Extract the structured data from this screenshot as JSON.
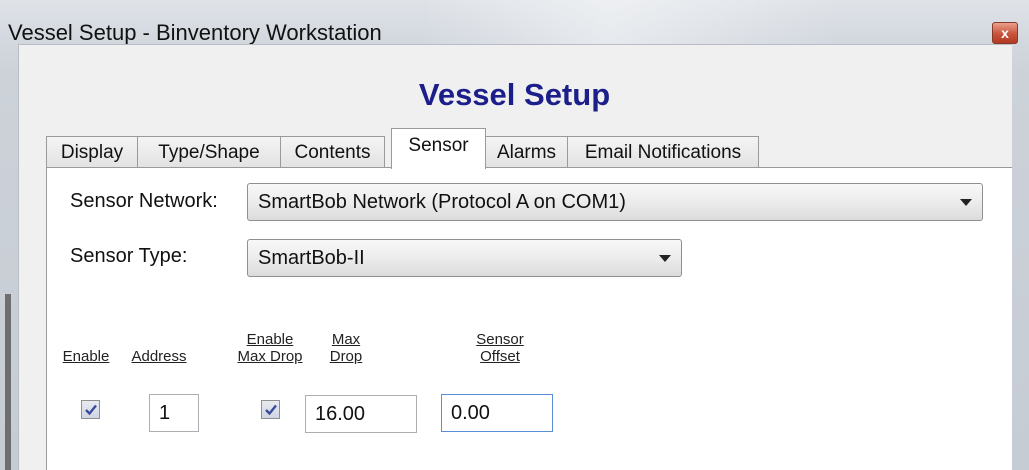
{
  "window": {
    "title": "Vessel Setup - Binventory Workstation",
    "close_glyph": "x"
  },
  "heading": "Vessel Setup",
  "tabs": [
    {
      "label": "Display",
      "active": false
    },
    {
      "label": "Type/Shape",
      "active": false
    },
    {
      "label": "Contents",
      "active": false
    },
    {
      "label": "Sensor",
      "active": true
    },
    {
      "label": "Alarms",
      "active": false
    },
    {
      "label": "Email Notifications",
      "active": false
    }
  ],
  "sensor": {
    "network_label": "Sensor Network:",
    "network_value": "SmartBob Network (Protocol A on COM1)",
    "type_label": "Sensor Type:",
    "type_value": "SmartBob-II"
  },
  "columns": {
    "enable": "Enable",
    "address": "Address",
    "enable_max_drop_1": "Enable",
    "enable_max_drop_2": "Max Drop",
    "max_drop_1": "Max",
    "max_drop_2": "Drop",
    "sensor_offset_1": "Sensor",
    "sensor_offset_2": "Offset"
  },
  "row": {
    "enable_checked": true,
    "address": "1",
    "enable_max_drop_checked": true,
    "max_drop": "16.00",
    "sensor_offset": "0.00"
  },
  "colors": {
    "heading": "#1c1f8a",
    "close_button": "#c9533a",
    "focus_border": "#5b8ed6"
  },
  "icons": [
    "close-icon",
    "dropdown-arrow-icon",
    "checkmark-icon"
  ]
}
